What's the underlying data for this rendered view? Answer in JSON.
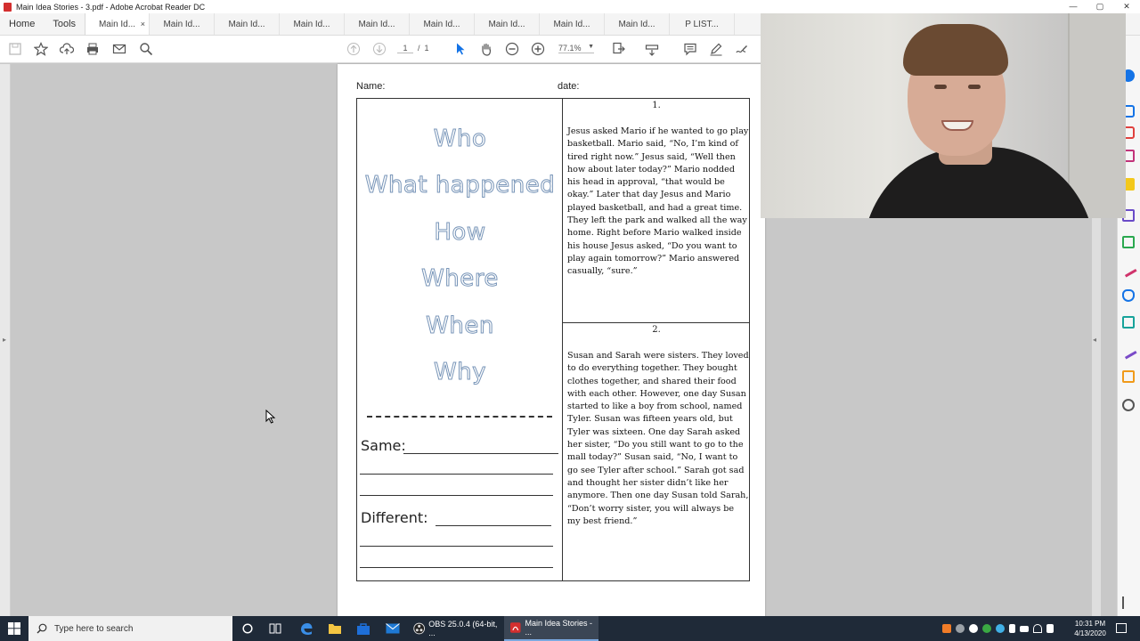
{
  "window": {
    "title": "Main Idea Stories - 3.pdf - Adobe Acrobat Reader DC",
    "controls": [
      "—",
      "▢",
      "✕"
    ]
  },
  "menu": {
    "home": "Home",
    "tools": "Tools"
  },
  "tabs": [
    {
      "label": "Main Id...",
      "active": true,
      "close": "×"
    },
    {
      "label": "Main Id...",
      "active": false
    },
    {
      "label": "Main Id...",
      "active": false
    },
    {
      "label": "Main Id...",
      "active": false
    },
    {
      "label": "Main Id...",
      "active": false
    },
    {
      "label": "Main Id...",
      "active": false
    },
    {
      "label": "Main Id...",
      "active": false
    },
    {
      "label": "Main Id...",
      "active": false
    },
    {
      "label": "Main Id...",
      "active": false
    },
    {
      "label": "P LIST...",
      "active": false
    }
  ],
  "toolbar": {
    "page_current": "1",
    "page_separator": "/",
    "page_total": "1",
    "zoom": "77.1%",
    "zoom_arrow": "▼"
  },
  "rails": {
    "left_arrow": "▸",
    "right_arrow": "◂"
  },
  "document": {
    "name_label": "Name:",
    "date_label": "date:",
    "question_words": [
      "Who",
      "What happened",
      "How",
      "Where",
      "When",
      "Why"
    ],
    "same_label": "Same:",
    "different_label": "Different:",
    "story1": {
      "number": "1.",
      "text": "Jesus asked Mario if he wanted to go play basketball. Mario said, “No, I’m kind of tired right now.” Jesus said, “Well then how about later today?” Mario nodded his head in approval, “that would be okay.” Later that day Jesus and Mario played basketball, and had a great time. They left the park and walked all the way home. Right before Mario walked inside his house Jesus asked, “Do you want to play again tomorrow?” Mario answered casually, “sure.”"
    },
    "story2": {
      "number": "2.",
      "text": "Susan and Sarah were sisters. They loved to do everything together. They bought clothes together, and shared their food with each other. However, one day Susan started to like a boy from school, named Tyler. Susan was fifteen years old, but Tyler was sixteen. One day Sarah asked her sister, “Do you still want to go to the mall today?” Susan said, “No, I want to go see Tyler after school.” Sarah got sad and thought her sister didn’t like her anymore. Then one day Susan told Sarah, “Don’t worry sister, you will always be my best friend.”"
    }
  },
  "taskbar": {
    "search_placeholder": "Type here to search",
    "obs_label": "OBS 25.0.4 (64-bit, ...",
    "acrobat_label": "Main Idea Stories - ...",
    "time": "10:31 PM",
    "date": "4/13/2020"
  },
  "colors": {
    "outline_text": "#7895b8",
    "acrobat_red": "#d32f2f",
    "taskbar": "#1f2a38"
  }
}
